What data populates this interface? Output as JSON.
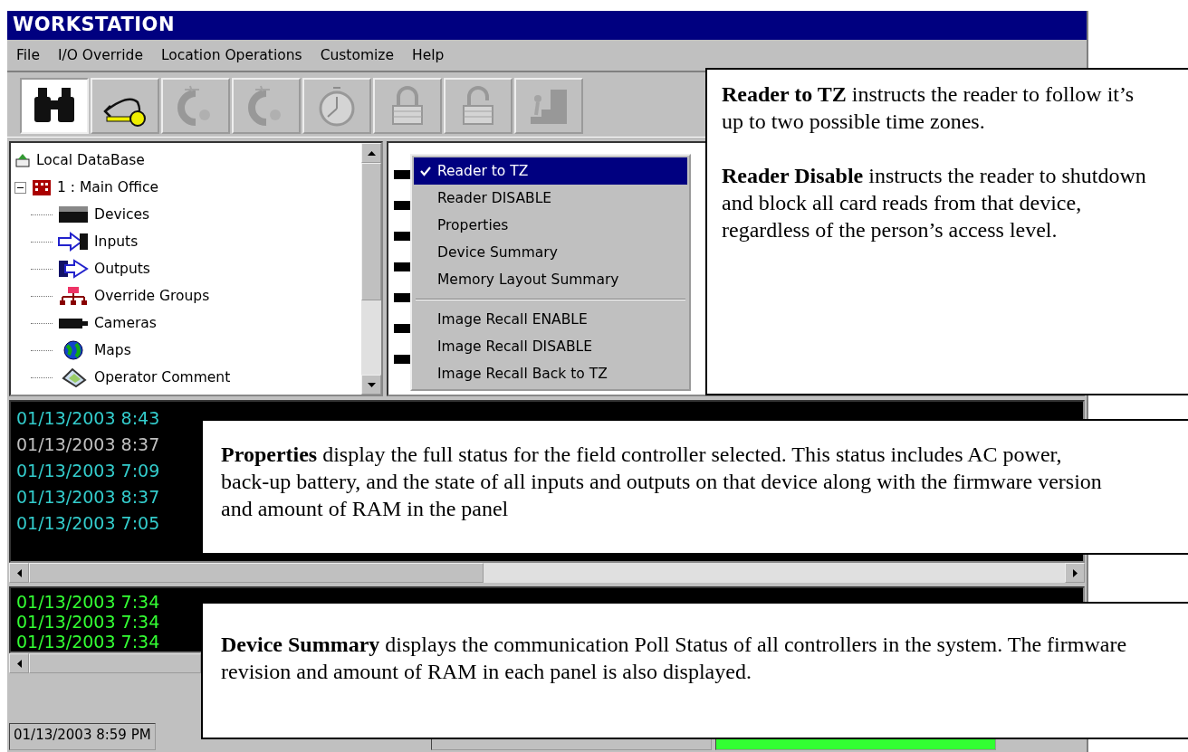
{
  "window": {
    "title": "WORKSTATION"
  },
  "menu": [
    "File",
    "I/O Override",
    "Location Operations",
    "Customize",
    "Help"
  ],
  "toolbar": [
    {
      "kind": "binoculars",
      "pressed": true,
      "disabled": false
    },
    {
      "kind": "key",
      "pressed": false,
      "disabled": false
    },
    {
      "kind": "light",
      "pressed": false,
      "disabled": true
    },
    {
      "kind": "light",
      "pressed": false,
      "disabled": true
    },
    {
      "kind": "stopwatch",
      "pressed": false,
      "disabled": true
    },
    {
      "kind": "lock",
      "pressed": false,
      "disabled": true
    },
    {
      "kind": "unlock",
      "pressed": false,
      "disabled": true
    },
    {
      "kind": "exit",
      "pressed": false,
      "disabled": true
    }
  ],
  "tree": {
    "root": "Local DataBase",
    "children": [
      {
        "label": "1 : Main Office",
        "expanded": true,
        "children": [
          {
            "label": "Devices",
            "kind": "device"
          },
          {
            "label": "Inputs",
            "kind": "input"
          },
          {
            "label": "Outputs",
            "kind": "output"
          },
          {
            "label": "Override Groups",
            "kind": "group"
          },
          {
            "label": "Cameras",
            "kind": "camera"
          },
          {
            "label": "Maps",
            "kind": "globe"
          },
          {
            "label": "Operator Comment",
            "kind": "comment"
          }
        ]
      }
    ]
  },
  "context_menu": [
    {
      "kind": "item",
      "label": "Reader to TZ",
      "checked": true,
      "selected": true
    },
    {
      "kind": "item",
      "label": "Reader DISABLE",
      "checked": false,
      "selected": false
    },
    {
      "kind": "item",
      "label": "Properties",
      "checked": false,
      "selected": false
    },
    {
      "kind": "item",
      "label": "Device Summary",
      "checked": false,
      "selected": false
    },
    {
      "kind": "item",
      "label": "Memory Layout Summary",
      "checked": false,
      "selected": false
    },
    {
      "kind": "separator"
    },
    {
      "kind": "item",
      "label": "Image Recall ENABLE",
      "checked": false,
      "selected": false
    },
    {
      "kind": "item",
      "label": "Image Recall DISABLE",
      "checked": false,
      "selected": false
    },
    {
      "kind": "item",
      "label": "Image Recall Back to TZ",
      "checked": false,
      "selected": false
    }
  ],
  "alarm_log": [
    {
      "text": "01/13/2003 8:43",
      "color": "#33cccc"
    },
    {
      "text": "01/13/2003 8:37",
      "color": "#c0c0c0"
    },
    {
      "text": "01/13/2003 7:09",
      "color": "#33cccc"
    },
    {
      "text": "01/13/2003 8:37",
      "color": "#33cccc"
    },
    {
      "text": "01/13/2003 7:05",
      "color": "#33cccc"
    }
  ],
  "event_log": [
    {
      "text": "01/13/2003 7:34",
      "color": "#33ff33"
    },
    {
      "text": "01/13/2003 7:34",
      "color": "#33ff33"
    },
    {
      "text": "01/13/2003 7:34",
      "color": "#33ff33"
    }
  ],
  "status_bar": {
    "datetime": "01/13/2003 8:59 PM"
  },
  "callouts": [
    {
      "paragraphs": [
        "**Reader to TZ** instructs the reader to follow it’s up to two possible time zones.",
        "**Reader Disable** instructs the reader to shutdown and block all card reads from that device, regardless of the person’s access level."
      ]
    },
    {
      "paragraphs": [
        "**Properties** display the full status for the field controller selected. This status includes AC power, back-up battery, and the state of all inputs and outputs on that device along with the firmware version and amount of RAM in the panel"
      ]
    },
    {
      "paragraphs": [
        "**Device Summary** displays the communication Poll Status of all controllers in the system. The firmware revision and amount of RAM in each panel is also displayed."
      ]
    }
  ]
}
